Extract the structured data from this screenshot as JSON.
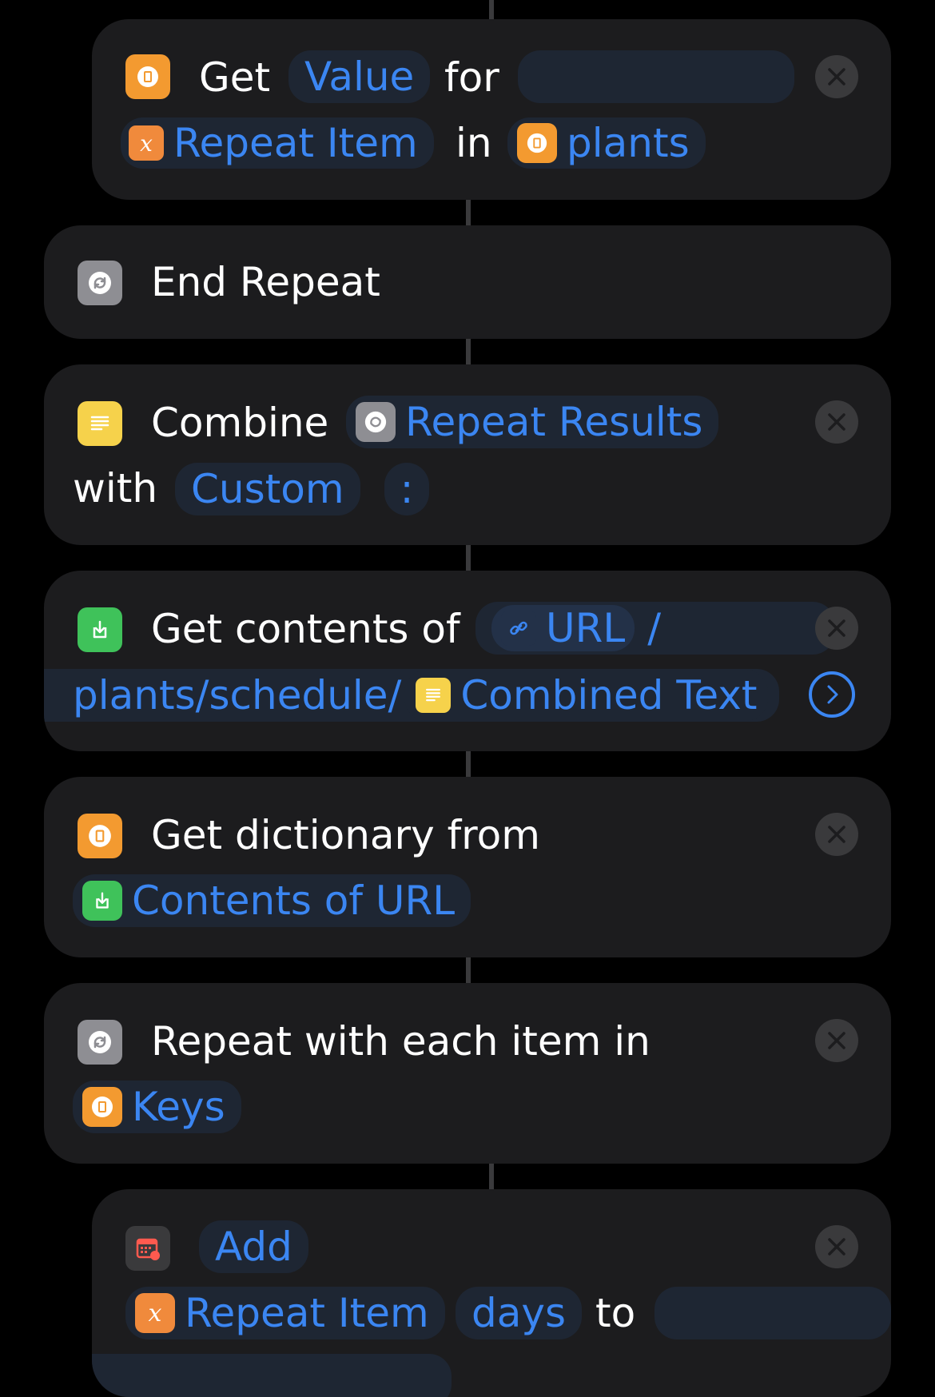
{
  "actions": {
    "get_value": {
      "verb": "Get",
      "param_value": "Value",
      "for_label": "for",
      "key_variable": "Repeat Item",
      "in_label": "in",
      "dict_variable": "plants"
    },
    "end_repeat": {
      "label": "End Repeat"
    },
    "combine": {
      "verb": "Combine",
      "input_variable": "Repeat Results",
      "with_label": "with",
      "separator_mode": "Custom",
      "separator_value": ":"
    },
    "get_contents": {
      "verb": "Get contents of",
      "url_variable": "URL",
      "url_slash": "/",
      "url_path": "plants/schedule/",
      "text_variable": "Combined Text"
    },
    "get_dictionary": {
      "verb": "Get dictionary from",
      "input_variable": "Contents of URL"
    },
    "repeat_each": {
      "verb": "Repeat with each item in",
      "input_variable": "Keys"
    },
    "add_date": {
      "operation": "Add",
      "amount_variable": "Repeat Item",
      "unit": "days",
      "to_label": "to"
    }
  },
  "colors": {
    "background": "#000000",
    "card": "#1c1c1e",
    "token_text": "#3b86f2",
    "token_bg": "#1e2633",
    "icon_orange": "#f39a30",
    "icon_yellow": "#f6d24b",
    "icon_green": "#3fc25a",
    "icon_gray": "#8e8e93"
  },
  "icons": {
    "dictionary": "dictionary-icon",
    "variable": "variable-x-icon",
    "repeat": "repeat-icon",
    "text": "text-lines-icon",
    "download": "download-icon",
    "link": "link-icon",
    "calendar": "calendar-icon",
    "close": "close-icon",
    "chevron": "chevron-right-icon"
  }
}
